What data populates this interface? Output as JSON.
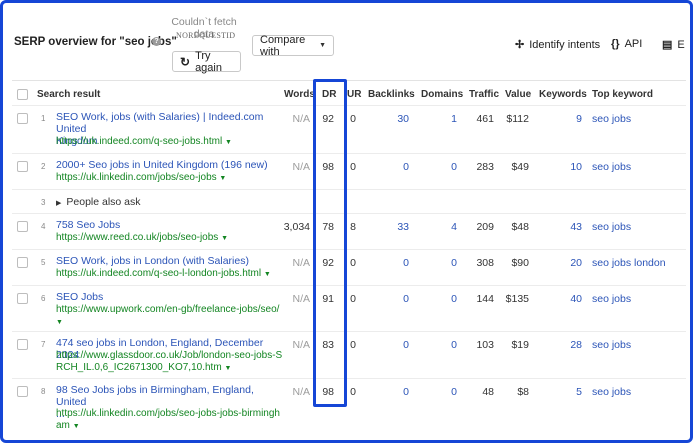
{
  "header": {
    "title": "SERP overview for \"seo jobs\"",
    "help_icon": "?",
    "fetch_error": "Couldn`t fetch data",
    "fetch_error_code": "NOREQUESTID",
    "compare_label": "Compare with",
    "retry_label": "Try again",
    "identify_intents_label": "Identify intents",
    "api_label": "API",
    "export_label": "E"
  },
  "columns": {
    "search_result": "Search result",
    "words": "Words",
    "dr": "DR",
    "ur": "UR",
    "backlinks": "Backlinks",
    "domains": "Domains",
    "traffic": "Traffic",
    "value": "Value",
    "keywords": "Keywords",
    "top_keyword": "Top keyword"
  },
  "rows": [
    {
      "rank": "1",
      "title_line1": "SEO Work, jobs (with Salaries) | Indeed.com United",
      "title_line2": "Kingdom",
      "url": "https://uk.indeed.com/q-seo-jobs.html",
      "words": "N/A",
      "dr": "92",
      "ur": "0",
      "backlinks": "30",
      "domains": "1",
      "traffic": "461",
      "value": "$112",
      "keywords": "9",
      "top_keyword": "seo jobs"
    },
    {
      "rank": "2",
      "title_line1": "2000+ Seo jobs in United Kingdom (196 new)",
      "url": "https://uk.linkedin.com/jobs/seo-jobs",
      "words": "N/A",
      "dr": "98",
      "ur": "0",
      "backlinks": "0",
      "domains": "0",
      "traffic": "283",
      "value": "$49",
      "keywords": "10",
      "top_keyword": "seo jobs"
    },
    {
      "rank": "3",
      "paa": "People also ask"
    },
    {
      "rank": "4",
      "title_line1": "758 Seo Jobs",
      "url": "https://www.reed.co.uk/jobs/seo-jobs",
      "words": "3,034",
      "dr": "78",
      "ur": "8",
      "backlinks": "33",
      "domains": "4",
      "traffic": "209",
      "value": "$48",
      "keywords": "43",
      "top_keyword": "seo jobs"
    },
    {
      "rank": "5",
      "title_line1": "SEO Work, jobs in London (with Salaries)",
      "url": "https://uk.indeed.com/q-seo-l-london-jobs.html",
      "words": "N/A",
      "dr": "92",
      "ur": "0",
      "backlinks": "0",
      "domains": "0",
      "traffic": "308",
      "value": "$90",
      "keywords": "20",
      "top_keyword": "seo jobs london"
    },
    {
      "rank": "6",
      "title_line1": "SEO Jobs",
      "url": "https://www.upwork.com/en-gb/freelance-jobs/seo/",
      "words": "N/A",
      "dr": "91",
      "ur": "0",
      "backlinks": "0",
      "domains": "0",
      "traffic": "144",
      "value": "$135",
      "keywords": "40",
      "top_keyword": "seo jobs"
    },
    {
      "rank": "7",
      "title_line1": "474 seo jobs in London, England, December 2024",
      "url_line1": "https://www.glassdoor.co.uk/Job/london-seo-jobs-S",
      "url_line2": "RCH_IL.0,6_IC2671300_KO7,10.htm",
      "words": "N/A",
      "dr": "83",
      "ur": "0",
      "backlinks": "0",
      "domains": "0",
      "traffic": "103",
      "value": "$19",
      "keywords": "28",
      "top_keyword": "seo jobs"
    },
    {
      "rank": "8",
      "title_line1": "98 Seo Jobs jobs in Birmingham, England, United",
      "title_line2": "...",
      "url_line1": "https://uk.linkedin.com/jobs/seo-jobs-jobs-birmingh",
      "url_line2": "am",
      "words": "N/A",
      "dr": "98",
      "ur": "0",
      "backlinks": "0",
      "domains": "0",
      "traffic": "48",
      "value": "$8",
      "keywords": "5",
      "top_keyword": "seo jobs"
    }
  ],
  "icons": {
    "help": "help-icon",
    "refresh": "refresh-icon",
    "identify_intents": "sparkle-icon",
    "api": "braces-icon",
    "export": "export-icon",
    "dropdown": "chevron-down-icon",
    "expand": "triangle-right-icon"
  },
  "colors": {
    "link": "#2b54b7",
    "url": "#138522",
    "highlight": "#1546d6",
    "muted": "#9c9c9c"
  }
}
